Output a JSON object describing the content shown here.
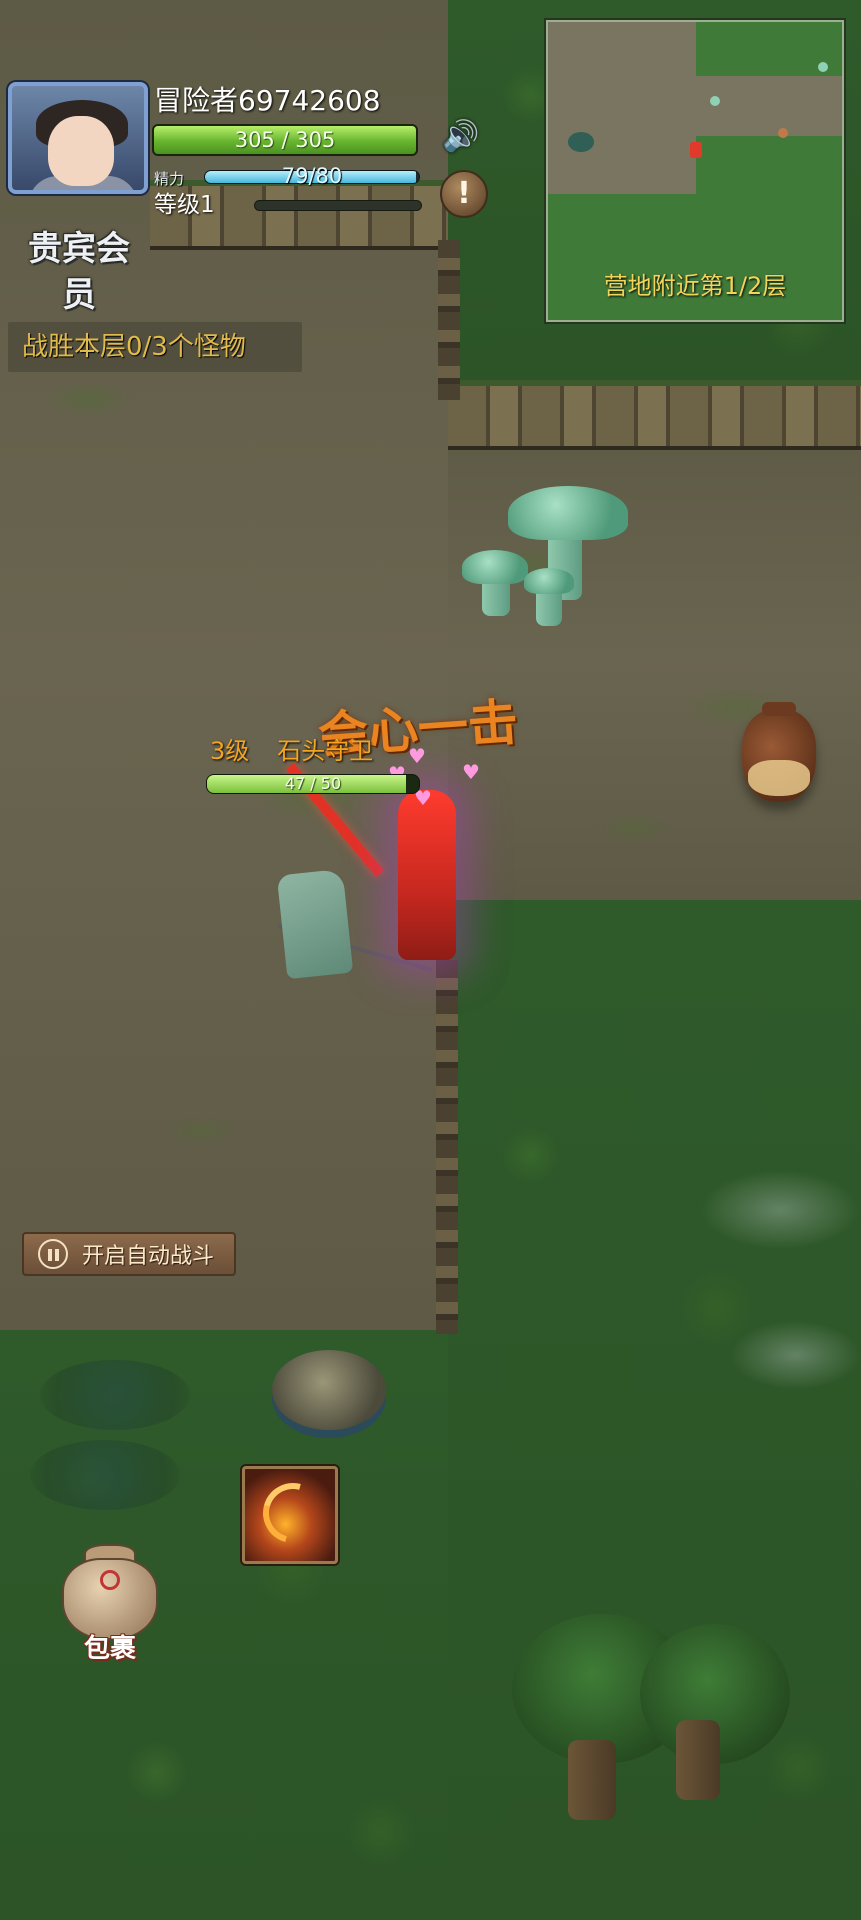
{
  "player": {
    "name": "冒险者69742608",
    "vip_label": "贵宾会员",
    "hp_text": "305 / 305",
    "hp_fraction": 1.0,
    "stamina_label": "精力",
    "stamina_text": "79/80",
    "stamina_fraction": 0.9875,
    "level_text": "等级1",
    "exp_fraction": 0.0
  },
  "hud": {
    "sound_icon": "speaker-icon",
    "alert_symbol": "!"
  },
  "minimap": {
    "location_label": "营地附近第1/2层"
  },
  "quest": {
    "text": "战胜本层0/3个怪物"
  },
  "battle": {
    "critical_text": "会心一击",
    "enemy_level": "3级",
    "enemy_name": "石头守卫",
    "enemy_hp_text": "47 / 50",
    "enemy_hp_fraction": 0.94
  },
  "controls": {
    "auto_battle_label": "开启自动战斗",
    "bag_label": "包裹",
    "skill_icon": "flame-slash-icon"
  },
  "colors": {
    "hp": "#67b52f",
    "stamina": "#46b7dd",
    "quest_text": "#e0ba4a",
    "minimap_label": "#f2d45a",
    "enemy_label": "#f5a41f",
    "critical_text": "#e98420"
  }
}
